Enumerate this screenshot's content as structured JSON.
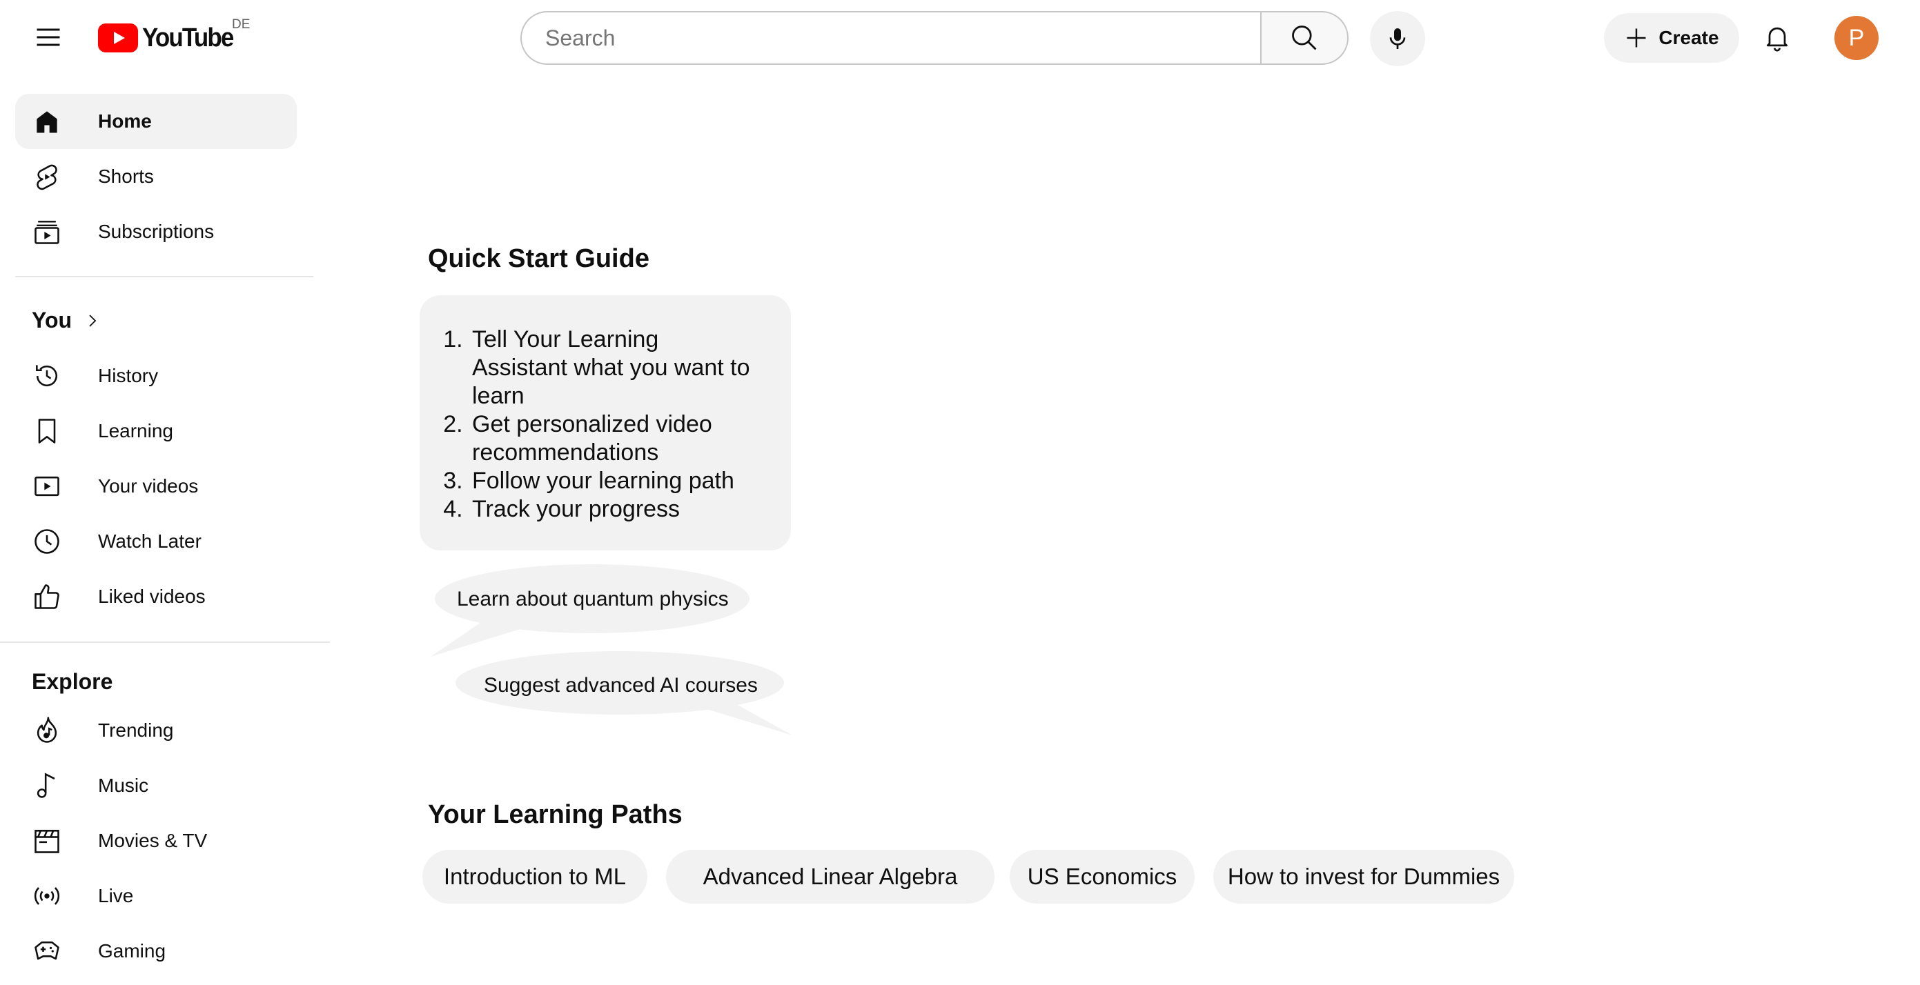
{
  "header": {
    "logo_text": "YouTube",
    "region": "DE",
    "search": {
      "placeholder": "Search",
      "value": ""
    },
    "create_label": "Create",
    "avatar_initial": "P",
    "avatar_color": "#e27833",
    "icons": [
      "menu-icon",
      "youtube-logo-icon",
      "search-icon",
      "microphone-icon",
      "plus-icon",
      "bell-icon"
    ]
  },
  "sidebar": {
    "main": [
      {
        "label": "Home",
        "icon": "home-icon",
        "active": true
      },
      {
        "label": "Shorts",
        "icon": "shorts-icon",
        "active": false
      },
      {
        "label": "Subscriptions",
        "icon": "subscriptions-icon",
        "active": false
      }
    ],
    "you": {
      "heading": "You",
      "items": [
        {
          "label": "History",
          "icon": "history-icon"
        },
        {
          "label": "Learning",
          "icon": "bookmark-icon"
        },
        {
          "label": "Your videos",
          "icon": "your-videos-icon"
        },
        {
          "label": "Watch Later",
          "icon": "clock-icon"
        },
        {
          "label": "Liked videos",
          "icon": "thumbs-up-icon"
        }
      ]
    },
    "explore": {
      "heading": "Explore",
      "items": [
        {
          "label": "Trending",
          "icon": "trending-icon"
        },
        {
          "label": "Music",
          "icon": "music-icon"
        },
        {
          "label": "Movies & TV",
          "icon": "clapperboard-icon"
        },
        {
          "label": "Live",
          "icon": "live-icon"
        },
        {
          "label": "Gaming",
          "icon": "gamepad-icon"
        }
      ]
    }
  },
  "main": {
    "quick_start": {
      "title": "Quick Start Guide",
      "steps": [
        "Tell Your Learning Assistant what you want to learn",
        "Get personalized video recommendations",
        "Follow your learning path",
        "Track your progress"
      ]
    },
    "suggestions": [
      "Learn about quantum physics",
      "Suggest advanced AI courses"
    ],
    "learning_paths": {
      "title": "Your Learning Paths",
      "items": [
        "Introduction to ML",
        "Advanced Linear Algebra",
        "US Economics",
        "How to invest for Dummies"
      ]
    }
  }
}
